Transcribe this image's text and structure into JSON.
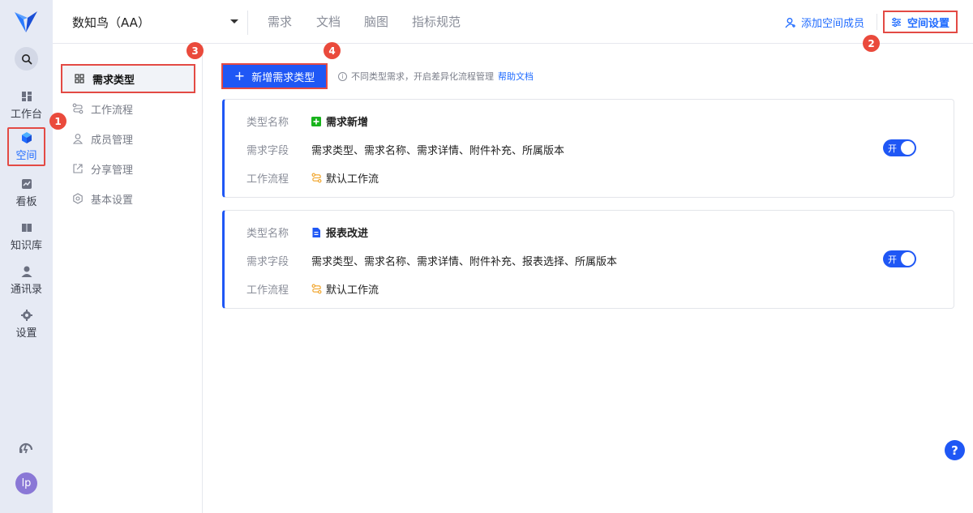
{
  "rail": {
    "items": [
      {
        "label": "工作台",
        "icon": "dashboard-icon"
      },
      {
        "label": "空间",
        "icon": "cube-icon"
      },
      {
        "label": "看板",
        "icon": "board-icon"
      },
      {
        "label": "知识库",
        "icon": "book-icon"
      },
      {
        "label": "通讯录",
        "icon": "contacts-icon"
      },
      {
        "label": "设置",
        "icon": "gear-icon"
      }
    ],
    "avatar": "lp"
  },
  "badges": [
    "1",
    "2",
    "3",
    "4"
  ],
  "topbar": {
    "space_name": "数知鸟（AA）",
    "tabs": [
      "需求",
      "文档",
      "脑图",
      "指标规范"
    ],
    "add_member": "添加空间成员",
    "space_settings": "空间设置"
  },
  "settings_nav": {
    "items": [
      "需求类型",
      "工作流程",
      "成员管理",
      "分享管理",
      "基本设置"
    ]
  },
  "main": {
    "new_button": "新增需求类型",
    "hint_text": "不同类型需求，开启差异化流程管理",
    "hint_icon": "i",
    "help_link": "帮助文档",
    "cards": [
      {
        "name_label": "类型名称",
        "name": "需求新增",
        "fields_label": "需求字段",
        "fields": "需求类型、需求名称、需求详情、附件补充、所属版本",
        "flow_label": "工作流程",
        "flow": "默认工作流",
        "toggle": "开",
        "icon_color": "#18b31c"
      },
      {
        "name_label": "类型名称",
        "name": "报表改进",
        "fields_label": "需求字段",
        "fields": "需求类型、需求名称、需求详情、附件补充、报表选择、所属版本",
        "flow_label": "工作流程",
        "flow": "默认工作流",
        "toggle": "开",
        "icon_color": "#1f57f5"
      }
    ],
    "help_fab": "?"
  },
  "colors": {
    "primary": "#1f57f5",
    "highlight": "#e34a44",
    "rail_bg": "#e6eaf4"
  }
}
